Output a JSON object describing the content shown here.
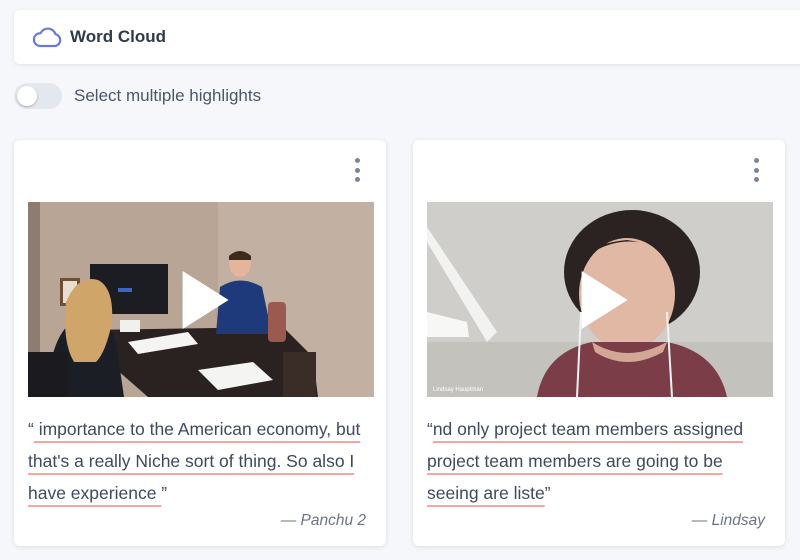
{
  "header": {
    "icon": "cloud-icon",
    "title": "Word Cloud",
    "accent": "#6b79d6"
  },
  "toggle": {
    "label": "Select multiple highlights",
    "on": false
  },
  "cards": [
    {
      "quote_open": "“",
      "quote": " importance to the American economy, but that's a really Niche sort of thing. So also I have experience ",
      "quote_close": "”",
      "author": "— Panchu 2"
    },
    {
      "quote_open": "“",
      "quote": "nd only project team members assigned project team members are going to be seeing are liste",
      "quote_close": "”",
      "author": "— Lindsay",
      "video_caption": "Lindsay Hauptman"
    }
  ]
}
